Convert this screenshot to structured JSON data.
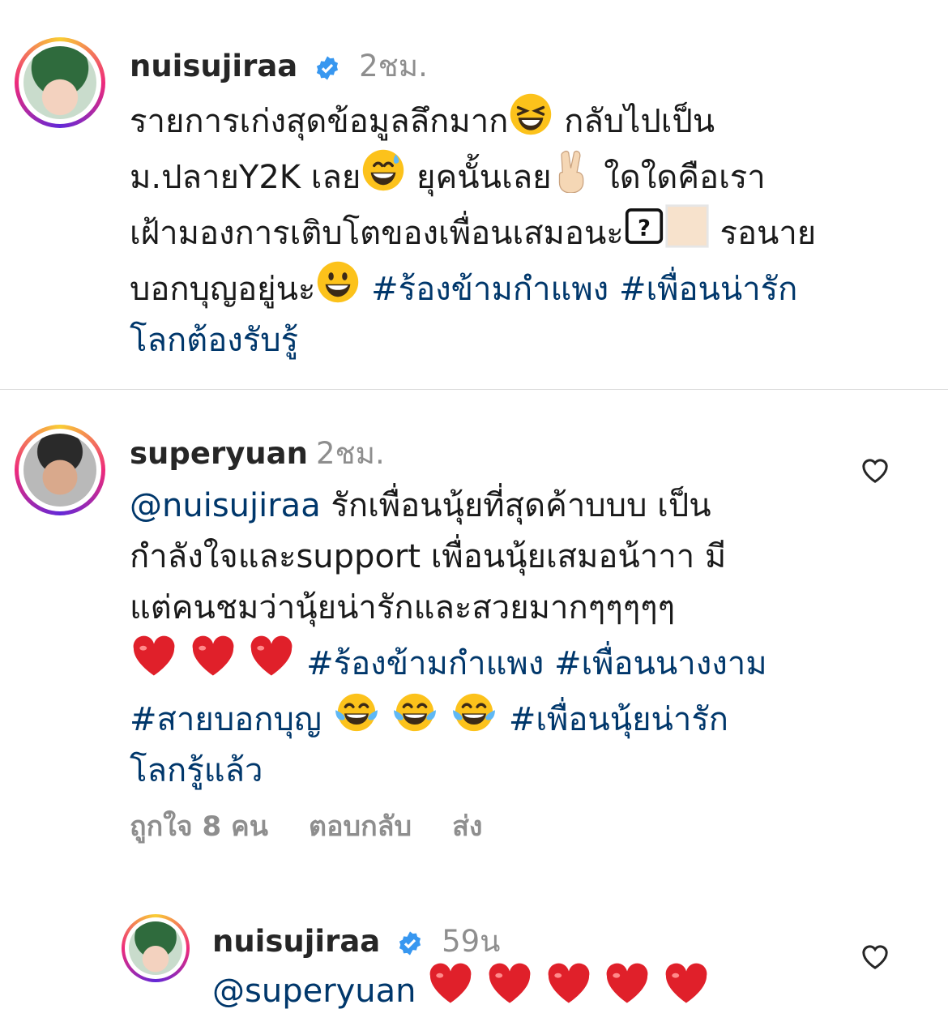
{
  "comments": [
    {
      "username": "nuisujiraa",
      "verified": true,
      "time": "2ชม.",
      "body": {
        "t1": "รายการเก่งสุดข้อมูลลึกมาก",
        "t2": " กลับไปเป็น",
        "t3": "ม.ปลายY2K เลย",
        "t4": " ยุคนั้นเลย",
        "t5": " ใดใดคือเรา",
        "t6": "เฝ้ามองการเติบโตของเพื่อนเสมอนะ",
        "t7": " รอนาย",
        "t8": "บอกบุญอยู่นะ",
        "tag1": "#ร้องข้ามกำแพง",
        "tag2": "#เพื่อนน่ารัก",
        "tag3": "โลกต้องรับรู้"
      }
    },
    {
      "username": "superyuan",
      "verified": false,
      "time": "2ชม.",
      "body": {
        "mention": "@nuisujiraa",
        "t1": " รักเพื่อนนุ้ยที่สุดค้าบบบ เป็น",
        "t2": "กำลังใจและsupport เพื่อนนุ้ยเสมอน้าาา มี",
        "t3": "แต่คนชมว่านุ้ยน่ารักและสวยมากๆๆๆๆๆ",
        "tag1": "#ร้องข้ามกำแพง",
        "tag2": "#เพื่อนนางงาม",
        "tag3": "#สายบอกบุญ",
        "tag4": "#เพื่อนนุ้ยน่ารัก",
        "tag5": "โลกรู้แล้ว"
      },
      "actions": {
        "likes": "ถูกใจ 8 คน",
        "reply": "ตอบกลับ",
        "send": "ส่ง"
      }
    },
    {
      "username": "nuisujiraa",
      "verified": true,
      "time": "59น",
      "body": {
        "mention": "@superyuan"
      }
    }
  ],
  "icons": {
    "verified": "verified-badge-icon",
    "like": "heart-outline-icon",
    "emoji_laugh": "grinning-squinting-face",
    "emoji_sweat": "grinning-face-with-sweat",
    "emoji_peace": "victory-hand",
    "emoji_unknown": "missing-glyph-box",
    "emoji_smile": "grinning-face",
    "emoji_heart": "red-heart",
    "emoji_tears": "face-with-tears-of-joy"
  },
  "colors": {
    "hashtag": "#00376b",
    "meta": "#8e8e8e",
    "verified": "#3797f0",
    "heart": "#e0202a"
  }
}
